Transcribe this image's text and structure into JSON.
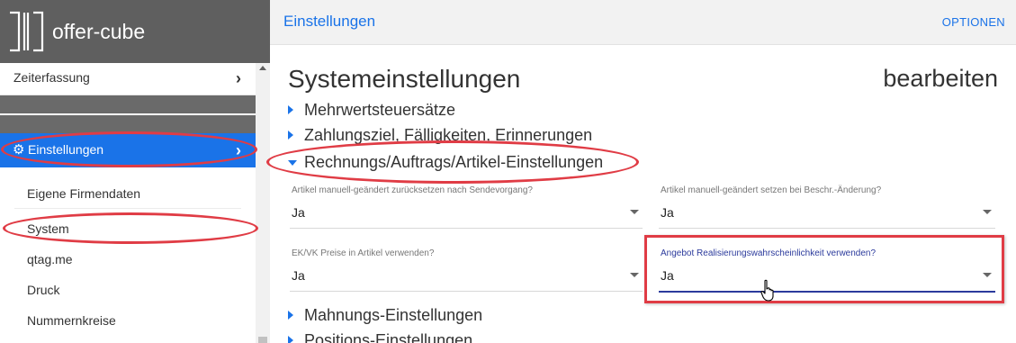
{
  "app": {
    "name": "offer-cube"
  },
  "sidebar": {
    "items": [
      {
        "label": "Zeiterfassung"
      },
      {
        "label": "Einstellungen",
        "icon": "gear-icon"
      }
    ],
    "sub_items": [
      {
        "label": "Eigene Firmendaten"
      },
      {
        "label": "System"
      },
      {
        "label": "qtag.me"
      },
      {
        "label": "Druck"
      },
      {
        "label": "Nummernkreise"
      }
    ]
  },
  "topbar": {
    "title": "Einstellungen",
    "options_label": "OPTIONEN"
  },
  "page": {
    "title": "Systemeinstellungen",
    "action": "bearbeiten"
  },
  "sections": [
    {
      "label": "Mehrwertsteuersätze",
      "expanded": false
    },
    {
      "label": "Zahlungsziel, Fälligkeiten, Erinnerungen",
      "expanded": false
    },
    {
      "label": "Rechnungs/Auftrags/Artikel-Einstellungen",
      "expanded": true
    },
    {
      "label": "Mahnungs-Einstellungen",
      "expanded": false
    },
    {
      "label": "Positions-Einstellungen",
      "expanded": false
    }
  ],
  "fields": [
    {
      "label": "Artikel manuell-geändert zurücksetzen nach Sendevorgang?",
      "value": "Ja"
    },
    {
      "label": "Artikel manuell-geändert setzen bei Beschr.-Änderung?",
      "value": "Ja"
    },
    {
      "label": "EK/VK Preise in Artikel verwenden?",
      "value": "Ja"
    },
    {
      "label": "Angebot Realisierungswahrscheinlichkeit verwenden?",
      "value": "Ja",
      "focused": true
    }
  ],
  "colors": {
    "accent": "#1a73e8",
    "sidebar_header": "#5f5f5f",
    "annotation": "#e03c45",
    "focus": "#2b3a9c"
  }
}
